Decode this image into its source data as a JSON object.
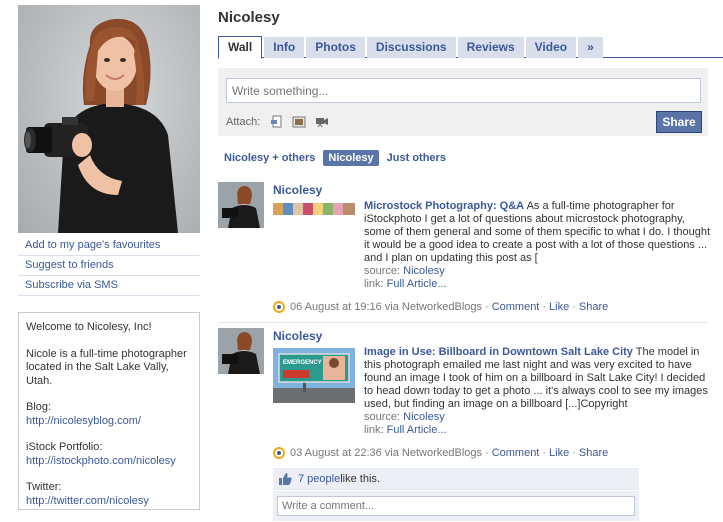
{
  "page": {
    "name": "Nicolesy"
  },
  "tabs": [
    {
      "label": "Wall"
    },
    {
      "label": "Info"
    },
    {
      "label": "Photos"
    },
    {
      "label": "Discussions"
    },
    {
      "label": "Reviews"
    },
    {
      "label": "Video"
    },
    {
      "label": "»"
    }
  ],
  "left_links": [
    {
      "label": "Add to my page's favourites"
    },
    {
      "label": "Suggest to friends"
    },
    {
      "label": "Subscribe via SMS"
    }
  ],
  "info": {
    "welcome": "Welcome to Nicolesy, Inc!",
    "bio": "Nicole is a full-time photographer located in the Salt Lake Vally, Utah.",
    "blog_label": "Blog:",
    "blog_url": "http://nicolesyblog.com/",
    "istock_label": "iStock Portfolio:",
    "istock_url": "http://istockphoto.com/nicolesy",
    "twitter_label": "Twitter:",
    "twitter_url": "http://twitter.com/nicolesy"
  },
  "composer": {
    "placeholder": "Write something...",
    "attach_label": "Attach:",
    "share_label": "Share"
  },
  "filters": [
    {
      "label": "Nicolesy + others"
    },
    {
      "label": "Nicolesy"
    },
    {
      "label": "Just others"
    }
  ],
  "posts": [
    {
      "author": "Nicolesy",
      "title": "Microstock Photography: Q&A",
      "text": " As a full-time photographer for iStockphoto I get a lot of questions about microstock photography, some of them general and some of them specific to what I do. I thought it would be a good idea to create a post with a lot of those questions ... and I plan on updating this post as [",
      "source_label": "source:",
      "source": "Nicolesy",
      "link_label": "link:",
      "link": "Full Article...",
      "date": "06 August at 19:16 via NetworkedBlogs",
      "actions": [
        "Comment",
        "Like",
        "Share"
      ]
    },
    {
      "author": "Nicolesy",
      "title": "Image in Use: Billboard in Downtown Salt Lake City",
      "text": " The model in this photograph emailed me last night and was very excited to have found an image I took of him on a billboard in Salt Lake City! I decided to head down today to get a photo ... it's always cool to see my images used, but finding an image on a billboard [...]Copyright",
      "source_label": "source:",
      "source": "Nicolesy",
      "link_label": "link:",
      "link": "Full Article...",
      "date": "03 August at 22:36 via NetworkedBlogs",
      "actions": [
        "Comment",
        "Like",
        "Share"
      ],
      "likes_link": "7 people",
      "likes_text": " like this.",
      "comment_placeholder": "Write a comment...",
      "billboard_text": "EMERGENCY CARE"
    }
  ],
  "colors": {
    "brand": "#3b5998",
    "tab_bg": "#d8dfea",
    "share_button": "#5b74a8",
    "networkedblogs_icon": "#f7a516"
  }
}
